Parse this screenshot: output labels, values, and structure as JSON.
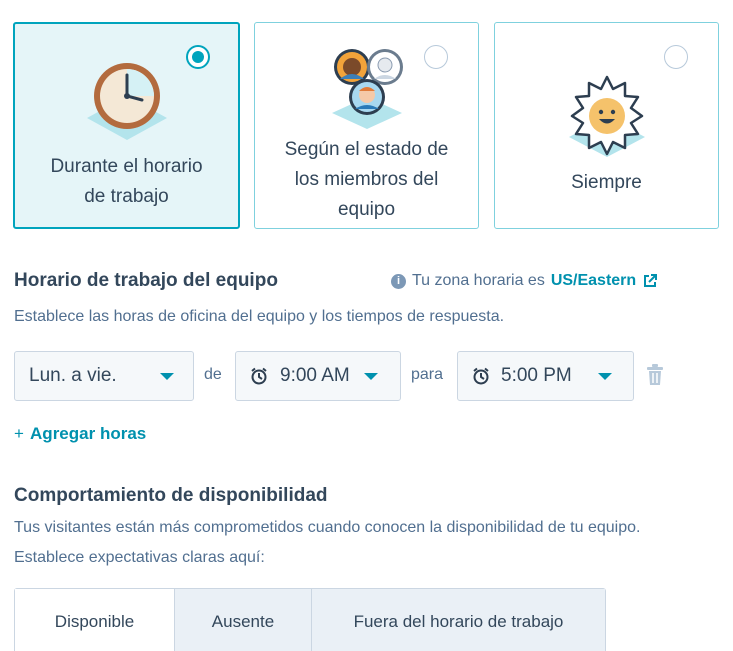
{
  "cards": [
    {
      "label_line1": "Durante el horario",
      "label_line2": "de trabajo",
      "selected": true,
      "icon": "clock-icon"
    },
    {
      "label_line1": "Según el estado de",
      "label_line2": "los miembros del",
      "label_line3": "equipo",
      "selected": false,
      "icon": "team-avatars-icon"
    },
    {
      "label_line1": "Siempre",
      "selected": false,
      "icon": "sun-icon"
    }
  ],
  "hours_section": {
    "title": "Horario de trabajo del equipo",
    "description": "Establece las horas de oficina del equipo y los tiempos de respuesta.",
    "timezone_prefix": "Tu zona horaria es",
    "timezone_value": "US/Eastern"
  },
  "schedule_row": {
    "days": "Lun. a vie.",
    "from_word": "de",
    "start_time": "9:00 AM",
    "to_word": "para",
    "end_time": "5:00 PM"
  },
  "add_hours": {
    "plus": "+",
    "label": "Agregar horas"
  },
  "availability_section": {
    "title": "Comportamiento de disponibilidad",
    "description_line1": "Tus visitantes están más comprometidos cuando conocen la disponibilidad de tu equipo.",
    "description_line2": "Establece expectativas claras aquí:"
  },
  "tabs": [
    {
      "label": "Disponible",
      "active": true
    },
    {
      "label": "Ausente",
      "active": false
    },
    {
      "label": "Fuera del horario de trabajo",
      "active": false
    }
  ],
  "colors": {
    "accent": "#00a4bd",
    "link": "#0091ae",
    "text": "#33475b",
    "muted": "#516f90"
  }
}
